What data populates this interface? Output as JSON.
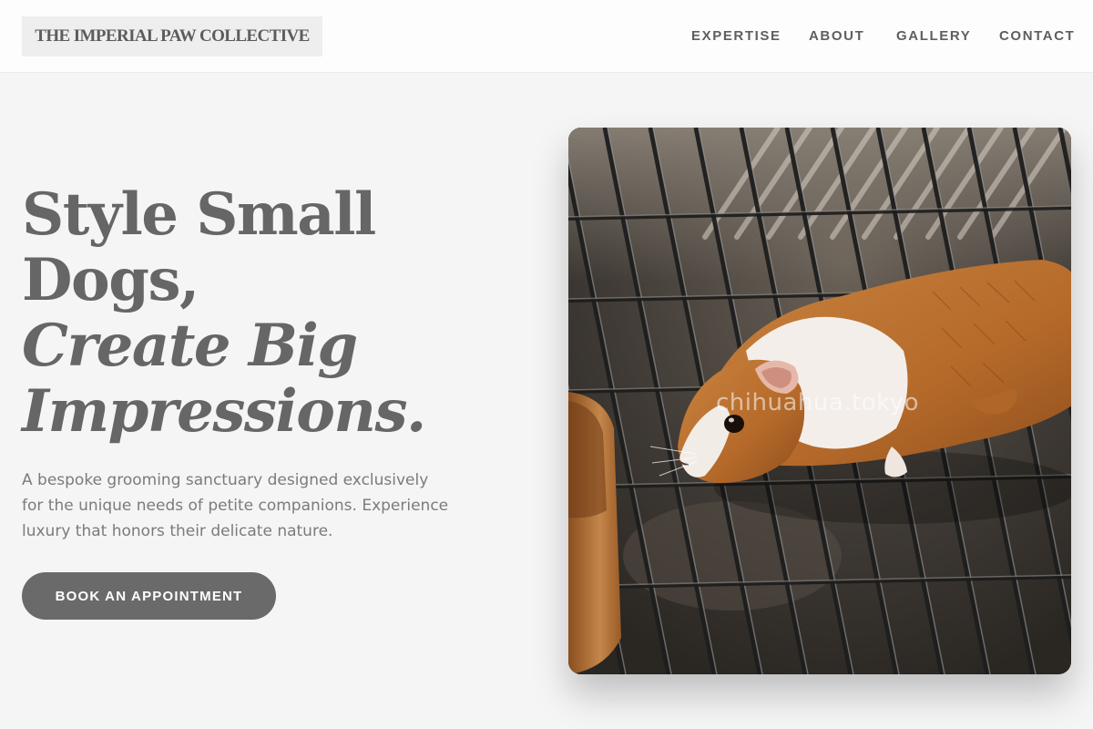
{
  "header": {
    "logo": "THE IMPERIAL PAW COLLECTIVE",
    "nav": [
      "EXPERTISE",
      "ABOUT",
      "GALLERY",
      "CONTACT"
    ]
  },
  "hero": {
    "title_lines": [
      "Style Small",
      "Dogs,",
      "Create Big",
      "Impressions."
    ],
    "description": "A bespoke grooming sanctuary designed exclusively for the unique needs of petite companions. Experience luxury that honors their delicate nature.",
    "cta_label": "BOOK AN APPOINTMENT",
    "image": {
      "subject": "guinea-pig-on-wire-grate",
      "watermark": "chihuahua.tokyo"
    }
  },
  "colors": {
    "background": "#f5f5f5",
    "header": "#fdfdfd",
    "text": "#666666",
    "button": "#6a6a6a"
  }
}
